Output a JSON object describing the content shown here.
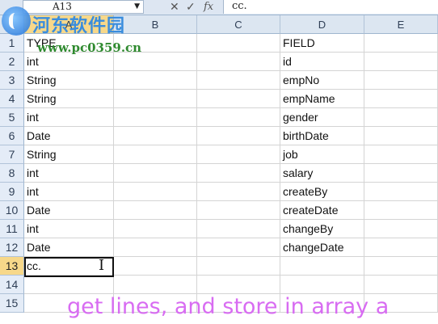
{
  "formula_bar": {
    "name_box": "A13",
    "cancel_icon": "✕",
    "enter_icon": "✓",
    "fx_label": "fx",
    "formula_value": "cc."
  },
  "columns": [
    "A",
    "B",
    "C",
    "D",
    "E"
  ],
  "rows": [
    {
      "num": "1",
      "a": "TYPE",
      "d": "FIELD"
    },
    {
      "num": "2",
      "a": "int",
      "d": "id"
    },
    {
      "num": "3",
      "a": "String",
      "d": "empNo"
    },
    {
      "num": "4",
      "a": "String",
      "d": "empName"
    },
    {
      "num": "5",
      "a": "int",
      "d": "gender"
    },
    {
      "num": "6",
      "a": "Date",
      "d": "birthDate"
    },
    {
      "num": "7",
      "a": "String",
      "d": "job"
    },
    {
      "num": "8",
      "a": "int",
      "d": "salary"
    },
    {
      "num": "9",
      "a": "int",
      "d": "createBy"
    },
    {
      "num": "10",
      "a": "Date",
      "d": "createDate"
    },
    {
      "num": "11",
      "a": "int",
      "d": "changeBy"
    },
    {
      "num": "12",
      "a": "Date",
      "d": "changeDate"
    },
    {
      "num": "13",
      "a": "cc.",
      "d": ""
    },
    {
      "num": "14",
      "a": "",
      "d": ""
    },
    {
      "num": "15",
      "a": "",
      "d": ""
    }
  ],
  "watermark": {
    "title": "河东软件园",
    "url": "www.pc0359.cn"
  },
  "caption": "get lines, and store in array a",
  "colors": {
    "caption": "#d86cf2",
    "header_bg": "#dce6f1",
    "selected_header": "#f7d88a"
  }
}
